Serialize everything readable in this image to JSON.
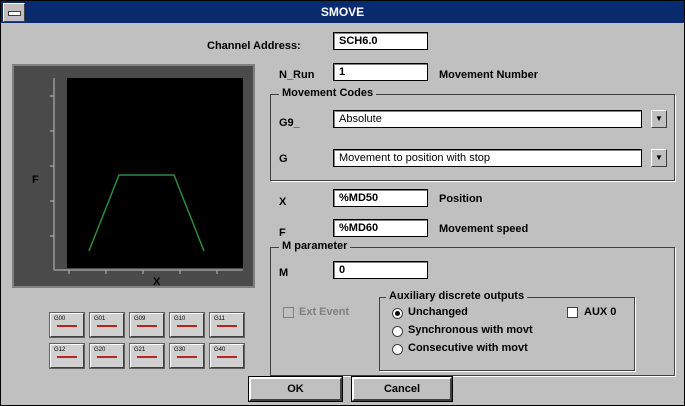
{
  "window": {
    "title": "SMOVE"
  },
  "channel_address": {
    "label": "Channel Address:",
    "value": "SCH6.0"
  },
  "n_run": {
    "label": "N_Run",
    "value": "1",
    "description": "Movement Number"
  },
  "movement_codes": {
    "title": "Movement Codes",
    "g9": {
      "label": "G9_",
      "value": "Absolute"
    },
    "g": {
      "label": "G",
      "value": "Movement to position with stop"
    }
  },
  "x": {
    "label": "X",
    "value": "%MD50",
    "description": "Position"
  },
  "f": {
    "label": "F",
    "value": "%MD60",
    "description": "Movement speed"
  },
  "m_parameter": {
    "title": "M parameter",
    "label": "M",
    "value": "0"
  },
  "ext_event": {
    "label": "Ext Event"
  },
  "aux_outputs": {
    "title": "Auxiliary discrete outputs",
    "options": [
      "Unchanged",
      "Synchronous with movt",
      "Consecutive with movt"
    ],
    "selected_index": 0
  },
  "aux0": {
    "label": "AUX 0"
  },
  "graph": {
    "ylabel": "F",
    "xlabel": "X",
    "line_color": "#2e8b3a"
  },
  "toolbar": {
    "row1": [
      "G00",
      "G01",
      "G09",
      "G10",
      "G11"
    ],
    "row2": [
      "G12",
      "G20",
      "G21",
      "G30",
      "G40"
    ]
  },
  "buttons": {
    "ok": "OK",
    "cancel": "Cancel"
  }
}
